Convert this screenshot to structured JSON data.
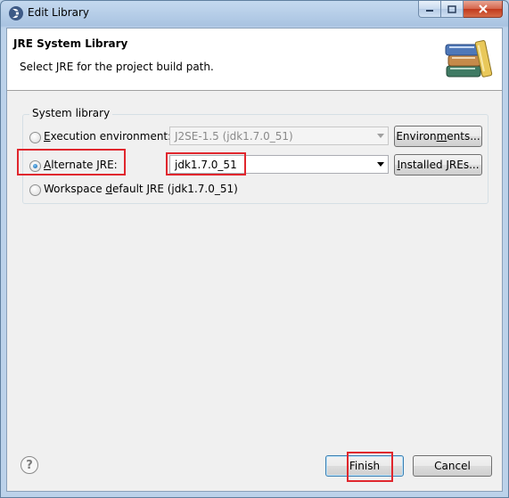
{
  "window": {
    "title": "Edit Library"
  },
  "header": {
    "title": "JRE System Library",
    "description": "Select JRE for the project build path."
  },
  "group": {
    "label": "System library"
  },
  "options": {
    "execution_environment": {
      "label_pre": "",
      "mnemonic": "E",
      "label_post": "xecution environment:",
      "selected": false,
      "combo_value": "J2SE-1.5 (jdk1.7.0_51)",
      "combo_disabled": true,
      "button_pre": "Environ",
      "button_mnemonic": "m",
      "button_post": "ents..."
    },
    "alternate_jre": {
      "label_pre": "",
      "mnemonic": "A",
      "label_post": "lternate JRE:",
      "selected": true,
      "combo_value": "jdk1.7.0_51",
      "combo_disabled": false,
      "button_pre": "",
      "button_mnemonic": "I",
      "button_post": "nstalled JREs..."
    },
    "workspace_default": {
      "label_pre": "Workspace ",
      "mnemonic": "d",
      "label_post": "efault JRE (jdk1.7.0_51)",
      "selected": false
    }
  },
  "footer": {
    "help_glyph": "?",
    "finish_label": "Finish",
    "cancel_label": "Cancel"
  },
  "highlight_color": "#e0262d",
  "accent_color": "#0d5fa8"
}
